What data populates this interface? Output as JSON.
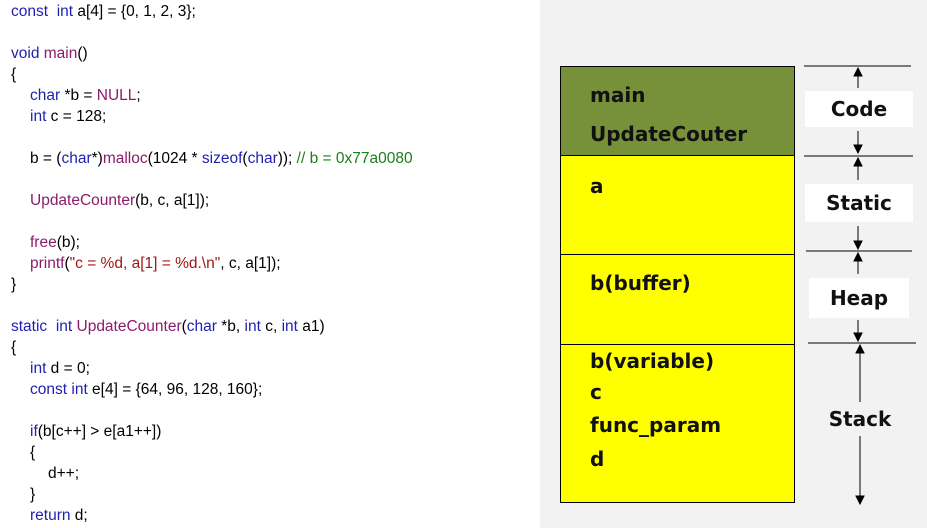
{
  "code": {
    "line1": {
      "kw1": "const",
      "kw2": "int",
      "rest": " a[4] = {0, 1, 2, 3};"
    },
    "line2": {
      "kw": "void",
      "fn": "main",
      "rest": "()"
    },
    "line3": "{",
    "line4": {
      "kw": "char",
      "mid": " *b = ",
      "nul": "NULL",
      "end": ";"
    },
    "line5": {
      "kw": "int",
      "rest": " c = 128;"
    },
    "line6": {
      "pre": "b = (",
      "kw": "char",
      "mid": "*)",
      "fn": "malloc",
      "mid2": "(1024 * ",
      "fn2": "sizeof",
      "mid3": "(",
      "kw2": "char",
      "end": ")); ",
      "cmt": "// b = 0x77a0080"
    },
    "line7": {
      "fn": "UpdateCounter",
      "rest": "(b, c, a[1]);"
    },
    "line8": {
      "fn": "free",
      "rest": "(b);"
    },
    "line9": {
      "fn": "printf",
      "p1": "(",
      "str": "\"c = %d, a[1] = %d.\\n\"",
      "rest": ", c, a[1]);"
    },
    "line10": "}",
    "line11": {
      "kw1": "static",
      "kw2": "int",
      "fn": "UpdateCounter",
      "p1": "(",
      "kw3": "char",
      "p2": " *b, ",
      "kw4": "int",
      "p3": " c, ",
      "kw5": "int",
      "p4": " a1)"
    },
    "line12": "{",
    "line13": {
      "kw": "int",
      "rest": " d = 0;"
    },
    "line14": {
      "kw1": "const",
      "kw2": "int",
      "rest": " e[4] = {64, 96, 128, 160};"
    },
    "line15": {
      "kw": "if",
      "rest": "(b[c++] > e[a1++])"
    },
    "line16": "{",
    "line17": "d++;",
    "line18": "}",
    "line19": {
      "kw": "return",
      "rest": " d;"
    }
  },
  "diagram": {
    "code_segment": {
      "items": [
        "main",
        "UpdateCouter"
      ],
      "label": "Code"
    },
    "static_segment": {
      "items": [
        "a"
      ],
      "label": "Static"
    },
    "heap_segment": {
      "items": [
        "b(buffer)"
      ],
      "label": "Heap"
    },
    "stack_segment": {
      "items": [
        "b(variable)",
        "c",
        "func_param",
        "d"
      ],
      "label": "Stack"
    },
    "colors": {
      "code": "#77903a",
      "data": "#ffff00",
      "syntax_keyword": "#1f1fb0",
      "syntax_function": "#8b1c6b",
      "syntax_string": "#a31515",
      "syntax_comment": "#1a7f1a"
    }
  }
}
